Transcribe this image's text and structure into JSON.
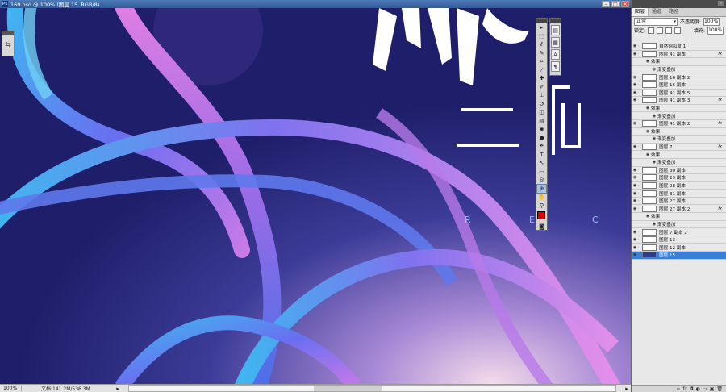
{
  "window": {
    "title": "169.psd @ 100% (图层 15, RGB/8)",
    "app_icon": "Ps"
  },
  "canvas": {
    "letters": [
      "R",
      "E",
      "C"
    ],
    "colors": {
      "background": "#1f1e6a",
      "accent_text": "#8fc1f0",
      "tube_pink": "#d77be6",
      "tube_blue": "#5b8df0"
    }
  },
  "toolbox": {
    "tools": [
      {
        "name": "move-tool",
        "glyph": "▸"
      },
      {
        "name": "marquee-tool",
        "glyph": "⬚"
      },
      {
        "name": "lasso-tool",
        "glyph": "ℓ"
      },
      {
        "name": "quick-select-tool",
        "glyph": "✎"
      },
      {
        "name": "crop-tool",
        "glyph": "⌗"
      },
      {
        "name": "eyedropper-tool",
        "glyph": "⁄"
      },
      {
        "name": "healing-tool",
        "glyph": "✚"
      },
      {
        "name": "brush-tool",
        "glyph": "✐"
      },
      {
        "name": "stamp-tool",
        "glyph": "⊥"
      },
      {
        "name": "history-brush-tool",
        "glyph": "↺"
      },
      {
        "name": "eraser-tool",
        "glyph": "◫"
      },
      {
        "name": "gradient-tool",
        "glyph": "▤"
      },
      {
        "name": "blur-tool",
        "glyph": "◉"
      },
      {
        "name": "dodge-tool",
        "glyph": "●"
      },
      {
        "name": "pen-tool",
        "glyph": "✒"
      },
      {
        "name": "type-tool",
        "glyph": "T"
      },
      {
        "name": "path-select-tool",
        "glyph": "↖"
      },
      {
        "name": "shape-tool",
        "glyph": "▭"
      },
      {
        "name": "3d-rotate-tool",
        "glyph": "◎"
      },
      {
        "name": "3d-orbit-tool",
        "glyph": "⊕"
      },
      {
        "name": "hand-tool",
        "glyph": "✋"
      },
      {
        "name": "zoom-tool",
        "glyph": "⚲"
      }
    ],
    "selected": "3d-orbit-tool",
    "foreground_color": "#e00000",
    "background_color": "#ffffff"
  },
  "dock": {
    "icons": [
      "history-icon",
      "actions-icon",
      "character-icon",
      "paragraph-icon"
    ],
    "glyphs": [
      "▤",
      "▦",
      "A",
      "¶"
    ]
  },
  "panel": {
    "tabs": [
      "图层",
      "通道",
      "路径"
    ],
    "blend_mode": "正常",
    "opacity_label": "不透明度:",
    "opacity_value": "100%",
    "lock_label": "锁定:",
    "fill_label": "填充:",
    "fill_value": "100%",
    "layers": [
      {
        "name": "自然饱和度 1",
        "type": "adjust",
        "fx": false
      },
      {
        "name": "图层 41 副本",
        "type": "layer",
        "fx": true
      },
      {
        "name": "效果",
        "type": "effects"
      },
      {
        "name": "渐变叠加",
        "type": "effect"
      },
      {
        "name": "图层 16 副本 2",
        "type": "layer",
        "fx": false
      },
      {
        "name": "图层 16 副本",
        "type": "layer",
        "fx": false
      },
      {
        "name": "图层 41 副本 5",
        "type": "layer",
        "fx": false
      },
      {
        "name": "图层 41 副本 3",
        "type": "layer",
        "fx": true
      },
      {
        "name": "效果",
        "type": "effects"
      },
      {
        "name": "渐变叠加",
        "type": "effect"
      },
      {
        "name": "图层 41 副本 2",
        "type": "layer",
        "fx": true
      },
      {
        "name": "效果",
        "type": "effects"
      },
      {
        "name": "渐变叠加",
        "type": "effect"
      },
      {
        "name": "图层 7",
        "type": "layer",
        "fx": true
      },
      {
        "name": "效果",
        "type": "effects"
      },
      {
        "name": "渐变叠加",
        "type": "effect"
      },
      {
        "name": "图层 30 副本",
        "type": "layer",
        "fx": false
      },
      {
        "name": "图层 29 副本",
        "type": "layer",
        "fx": false
      },
      {
        "name": "图层 28 副本",
        "type": "layer",
        "fx": false
      },
      {
        "name": "图层 31 副本",
        "type": "layer",
        "fx": false
      },
      {
        "name": "图层 27 副本",
        "type": "layer",
        "fx": false
      },
      {
        "name": "图层 27 副本 2",
        "type": "layer",
        "fx": true
      },
      {
        "name": "效果",
        "type": "effects"
      },
      {
        "name": "渐变叠加",
        "type": "effect"
      },
      {
        "name": "图层 7 副本 2",
        "type": "layer",
        "fx": false
      },
      {
        "name": "图层 13",
        "type": "layer",
        "fx": false
      },
      {
        "name": "图层 12 副本",
        "type": "layer",
        "fx": false
      },
      {
        "name": "图层 15",
        "type": "layer",
        "fx": false,
        "selected": true
      }
    ],
    "footer_icons": [
      "link-icon",
      "fx-icon",
      "mask-icon",
      "adjustment-icon",
      "folder-icon",
      "new-layer-icon",
      "trash-icon"
    ],
    "footer_glyphs": [
      "∞",
      "fx",
      "◘",
      "◐",
      "▭",
      "▣",
      "🗑"
    ]
  },
  "status": {
    "zoom": "100%",
    "doc": "文档:141.2M/536.3M"
  }
}
